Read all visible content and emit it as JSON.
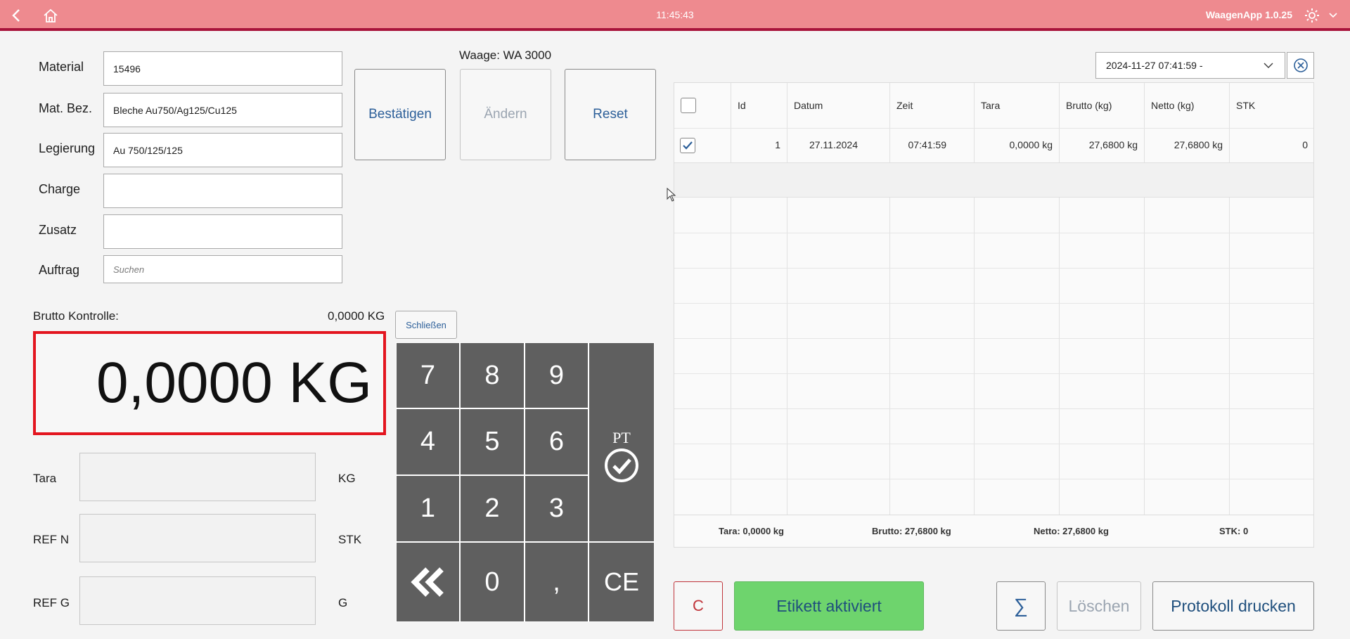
{
  "header": {
    "time": "11:45:43",
    "app_name": "WaagenApp 1.0.25"
  },
  "form": {
    "material_label": "Material",
    "material_value": "15496",
    "matbez_label": "Mat. Bez.",
    "matbez_value": "Bleche Au750/Ag125/Cu125",
    "legierung_label": "Legierung",
    "legierung_value": "Au 750/125/125",
    "charge_label": "Charge",
    "charge_value": "",
    "zusatz_label": "Zusatz",
    "zusatz_value": "",
    "auftrag_label": "Auftrag",
    "auftrag_placeholder": "Suchen"
  },
  "actions": {
    "scale": "Waage: WA 3000",
    "confirm": "Bestätigen",
    "change": "Ändern",
    "reset": "Reset"
  },
  "weight": {
    "brutto_label": "Brutto Kontrolle:",
    "brutto_small": "0,0000 KG",
    "display": "0,0000 KG",
    "close": "Schließen",
    "tara_label": "Tara",
    "tara_unit": "KG",
    "refn_label": "REF N",
    "refn_unit": "STK",
    "refg_label": "REF G",
    "refg_unit": "G"
  },
  "keypad": {
    "k7": "7",
    "k8": "8",
    "k9": "9",
    "k4": "4",
    "k5": "5",
    "k6": "6",
    "k1": "1",
    "k2": "2",
    "k3": "3",
    "k0": "0",
    "comma": ",",
    "ce": "CE",
    "pt": "PT"
  },
  "filter": {
    "date": "2024-11-27 07:41:59 -"
  },
  "table": {
    "columns": [
      "Id",
      "Datum",
      "Zeit",
      "Tara",
      "Brutto (kg)",
      "Netto (kg)",
      "STK"
    ],
    "rows": [
      {
        "id": "1",
        "datum": "27.11.2024",
        "zeit": "07:41:59",
        "tara": "0,0000 kg",
        "brutto": "27,6800 kg",
        "netto": "27,6800 kg",
        "stk": "0"
      }
    ],
    "footer": {
      "tara": "Tara: 0,0000 kg",
      "brutto": "Brutto: 27,6800 kg",
      "netto": "Netto: 27,6800 kg",
      "stk": "STK: 0"
    }
  },
  "bottom": {
    "clear": "C",
    "label": "Etikett aktiviert",
    "sum": "∑",
    "delete": "Löschen",
    "print": "Protokoll drucken"
  },
  "colors": {
    "header": "#ee8a8f",
    "header_line": "#a8133a",
    "display_border": "#e3151f",
    "label_btn": "#6ed46d",
    "accent": "#2c5f99"
  }
}
